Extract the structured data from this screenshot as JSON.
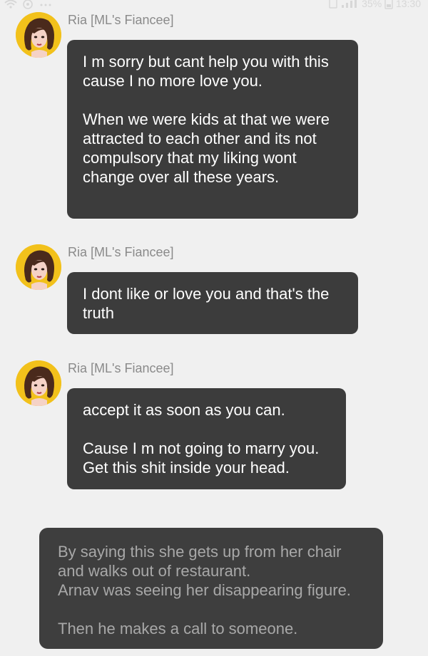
{
  "status_bar": {
    "left_icons": [
      "wifi-icon",
      "mail-icon",
      "ellipsis-icon"
    ],
    "battery_percent": "35%",
    "time": "13:30"
  },
  "messages": [
    {
      "sender": "Ria [ML's Fiancee]",
      "text": "I m sorry but cant help you with this\ncause I no more love you.\n\nWhen we were kids at that we were attracted to each other and its not compulsory that my liking wont change over all these years."
    },
    {
      "sender": "Ria [ML's Fiancee]",
      "text": "I dont like or love you and that's the truth"
    },
    {
      "sender": "Ria [ML's Fiancee]",
      "text": "accept it as soon as you can.\n\nCause I m not going to marry you.\nGet this shit inside your head."
    }
  ],
  "narration": "By saying this she gets up from her chair and walks out of restaurant.\nArnav was seeing her disappearing figure.\n\nThen he makes a call to someone."
}
